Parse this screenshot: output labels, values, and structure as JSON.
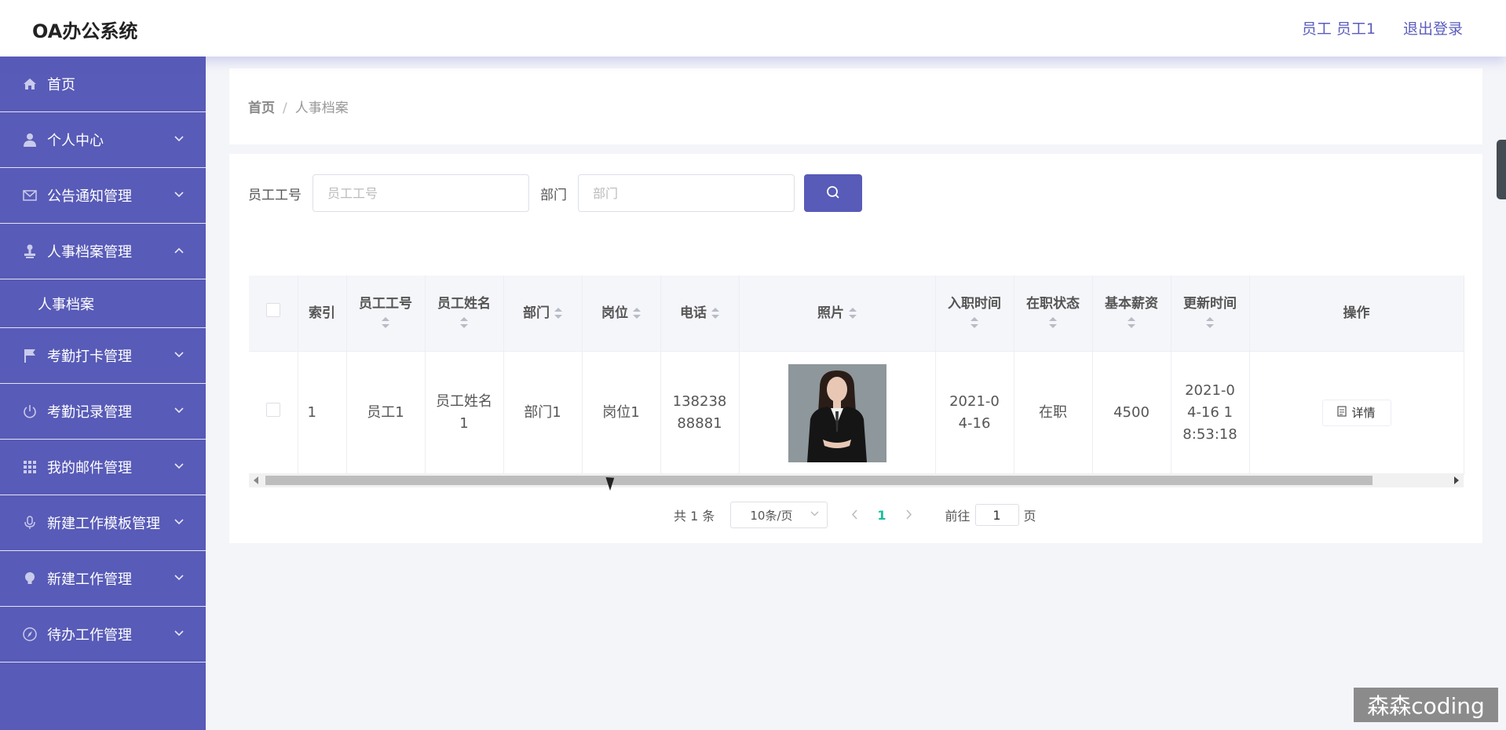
{
  "app": {
    "title": "OA办公系统"
  },
  "header": {
    "user": "员工 员工1",
    "logout": "退出登录"
  },
  "sidebar": {
    "items": [
      {
        "label": "首页",
        "icon": "home-icon"
      },
      {
        "label": "个人中心",
        "icon": "user-icon"
      },
      {
        "label": "公告通知管理",
        "icon": "mail-icon"
      },
      {
        "label": "人事档案管理",
        "icon": "stamp-icon",
        "expanded": true,
        "sub": [
          "人事档案"
        ]
      },
      {
        "label": "考勤打卡管理",
        "icon": "flag-icon"
      },
      {
        "label": "考勤记录管理",
        "icon": "power-icon"
      },
      {
        "label": "我的邮件管理",
        "icon": "grid-icon"
      },
      {
        "label": "新建工作模板管理",
        "icon": "mic-icon"
      },
      {
        "label": "新建工作管理",
        "icon": "bulb-icon"
      },
      {
        "label": "待办工作管理",
        "icon": "compass-icon"
      }
    ]
  },
  "breadcrumb": {
    "home": "首页",
    "separator": "/",
    "current": "人事档案"
  },
  "search": {
    "emp_no_label": "员工工号",
    "emp_no_placeholder": "员工工号",
    "dept_label": "部门",
    "dept_placeholder": "部门"
  },
  "table": {
    "headers": {
      "index": "索引",
      "emp_no": "员工工号",
      "emp_name": "员工姓名",
      "dept": "部门",
      "post": "岗位",
      "phone": "电话",
      "photo": "照片",
      "join_date": "入职时间",
      "status": "在职状态",
      "salary": "基本薪资",
      "updated": "更新时间",
      "actions": "操作"
    },
    "rows": [
      {
        "index": "1",
        "emp_no": "员工1",
        "emp_name": "员工姓名1",
        "dept": "部门1",
        "post": "岗位1",
        "phone": "13823888881",
        "join_date": "2021-04-16",
        "status": "在职",
        "salary": "4500",
        "updated": "2021-04-16 18:53:18",
        "detail": "详情"
      }
    ]
  },
  "pagination": {
    "total": "共 1 条",
    "page_size": "10条/页",
    "current": "1",
    "goto_prefix": "前往",
    "goto_value": "1",
    "goto_suffix": "页"
  },
  "watermark": "森森coding",
  "colors": {
    "primary": "#585bb7",
    "active_page": "#1bbc9b"
  }
}
